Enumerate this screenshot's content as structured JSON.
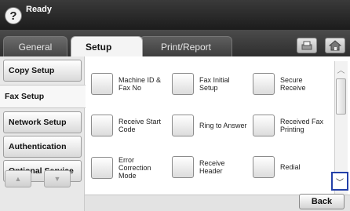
{
  "status": {
    "text": "Ready",
    "help_glyph": "?"
  },
  "tabs": [
    {
      "label": "General"
    },
    {
      "label": "Setup"
    },
    {
      "label": "Print/Report"
    }
  ],
  "tab_icons": [
    "copy-icon",
    "home-icon"
  ],
  "menu": {
    "items": [
      {
        "label": "Copy Setup"
      },
      {
        "label": "Fax Setup"
      },
      {
        "label": "Network Setup"
      },
      {
        "label": "Authentication"
      },
      {
        "label": "Optional Service"
      }
    ],
    "active": "Fax Setup"
  },
  "options": [
    {
      "line1": "Machine ID &",
      "line2": "Fax No"
    },
    {
      "line1": "Fax Initial",
      "line2": "Setup"
    },
    {
      "line1": "Secure Receive",
      "line2": ""
    },
    {
      "line1": "Receive Start",
      "line2": "Code"
    },
    {
      "line1": "Ring to Answer",
      "line2": ""
    },
    {
      "line1": "Received Fax",
      "line2": "Printing"
    },
    {
      "line1": "Error Correction",
      "line2": "Mode"
    },
    {
      "line1": "Receive Header",
      "line2": ""
    },
    {
      "line1": "Redial",
      "line2": ""
    }
  ],
  "buttons": {
    "back": "Back"
  },
  "colors": {
    "highlight": "#2440a8",
    "topbar": "#2a2a2a"
  }
}
